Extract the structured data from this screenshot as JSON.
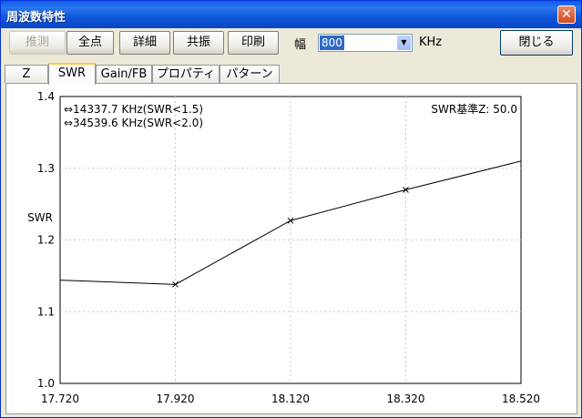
{
  "window": {
    "title": "周波数特性",
    "close_glyph": "✕"
  },
  "toolbar": {
    "buttons": [
      "推測",
      "全点",
      "詳細",
      "共振",
      "印刷"
    ],
    "width_label": "幅",
    "width_value": "800",
    "width_unit": "KHz",
    "close_label": "閉じる"
  },
  "tabs": [
    "Z",
    "SWR",
    "Gain/FB",
    "プロパティ",
    "パターン"
  ],
  "active_tab": "SWR",
  "chart_data": {
    "type": "line",
    "ylabel": "SWR",
    "xlabel": "",
    "xlim": [
      17.72,
      18.52
    ],
    "ylim": [
      1.0,
      1.4
    ],
    "x_ticks": [
      "17.720",
      "17.920",
      "18.120",
      "18.320",
      "18.520"
    ],
    "y_ticks": [
      "1.0",
      "1.1",
      "1.2",
      "1.3",
      "1.4"
    ],
    "grid": true,
    "annotations": [
      "⇔14337.7 KHz(SWR<1.5)",
      "⇔34539.6 KHz(SWR<2.0)",
      "SWR基準Z: 50.0"
    ],
    "series": [
      {
        "x": [
          17.72,
          17.92,
          18.12,
          18.32,
          18.52
        ],
        "y": [
          1.144,
          1.138,
          1.227,
          1.27,
          1.31
        ],
        "markers": [
          false,
          true,
          true,
          true,
          false
        ]
      }
    ]
  }
}
